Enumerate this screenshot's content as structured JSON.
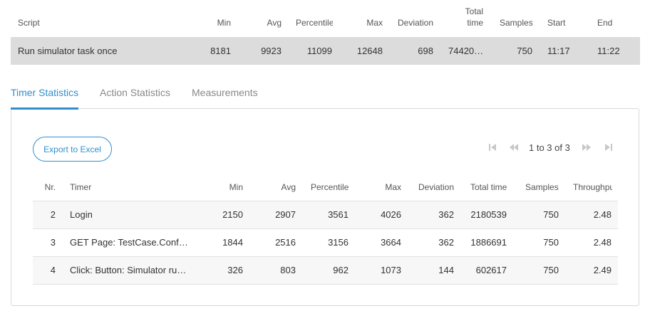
{
  "script_table": {
    "headers": {
      "script": "Script",
      "min": "Min",
      "avg": "Avg",
      "percentile": "Percentile",
      "max": "Max",
      "deviation": "Deviation",
      "total_time_line1": "Total",
      "total_time_line2": "time",
      "samples": "Samples",
      "start": "Start",
      "end": "End"
    },
    "row": {
      "script": "Run simulator task once",
      "min": "8181",
      "avg": "9923",
      "percentile": "11099",
      "max": "12648",
      "deviation": "698",
      "total_time": "74420…",
      "samples": "750",
      "start": "11:17",
      "end": "11:22"
    }
  },
  "tabs": [
    {
      "label": "Timer Statistics",
      "active": true
    },
    {
      "label": "Action Statistics",
      "active": false
    },
    {
      "label": "Measurements",
      "active": false
    }
  ],
  "toolbar": {
    "export_label": "Export to Excel"
  },
  "pagination": {
    "text": "1 to 3 of 3",
    "icons": [
      "first-page-icon",
      "previous-page-icon",
      "next-page-icon",
      "last-page-icon"
    ]
  },
  "timer_table": {
    "headers": {
      "nr": "Nr.",
      "timer": "Timer",
      "min": "Min",
      "avg": "Avg",
      "percentile": "Percentile",
      "max": "Max",
      "deviation": "Deviation",
      "total_time": "Total time",
      "samples": "Samples",
      "throughput": "Throughput"
    },
    "rows": [
      {
        "nr": "2",
        "timer": "Login",
        "min": "2150",
        "avg": "2907",
        "percentile": "3561",
        "max": "4026",
        "deviation": "362",
        "total_time": "2180539",
        "samples": "750",
        "throughput": "2.48"
      },
      {
        "nr": "3",
        "timer": "GET Page: TestCase.Conf…",
        "min": "1844",
        "avg": "2516",
        "percentile": "3156",
        "max": "3664",
        "deviation": "362",
        "total_time": "1886691",
        "samples": "750",
        "throughput": "2.48"
      },
      {
        "nr": "4",
        "timer": "Click: Button: Simulator ru…",
        "min": "326",
        "avg": "803",
        "percentile": "962",
        "max": "1073",
        "deviation": "144",
        "total_time": "602617",
        "samples": "750",
        "throughput": "2.49"
      }
    ]
  },
  "colors": {
    "accent": "#2f8fce",
    "script_row_bg": "#dcdcdc",
    "pager_icon": "#c8c8c8"
  }
}
